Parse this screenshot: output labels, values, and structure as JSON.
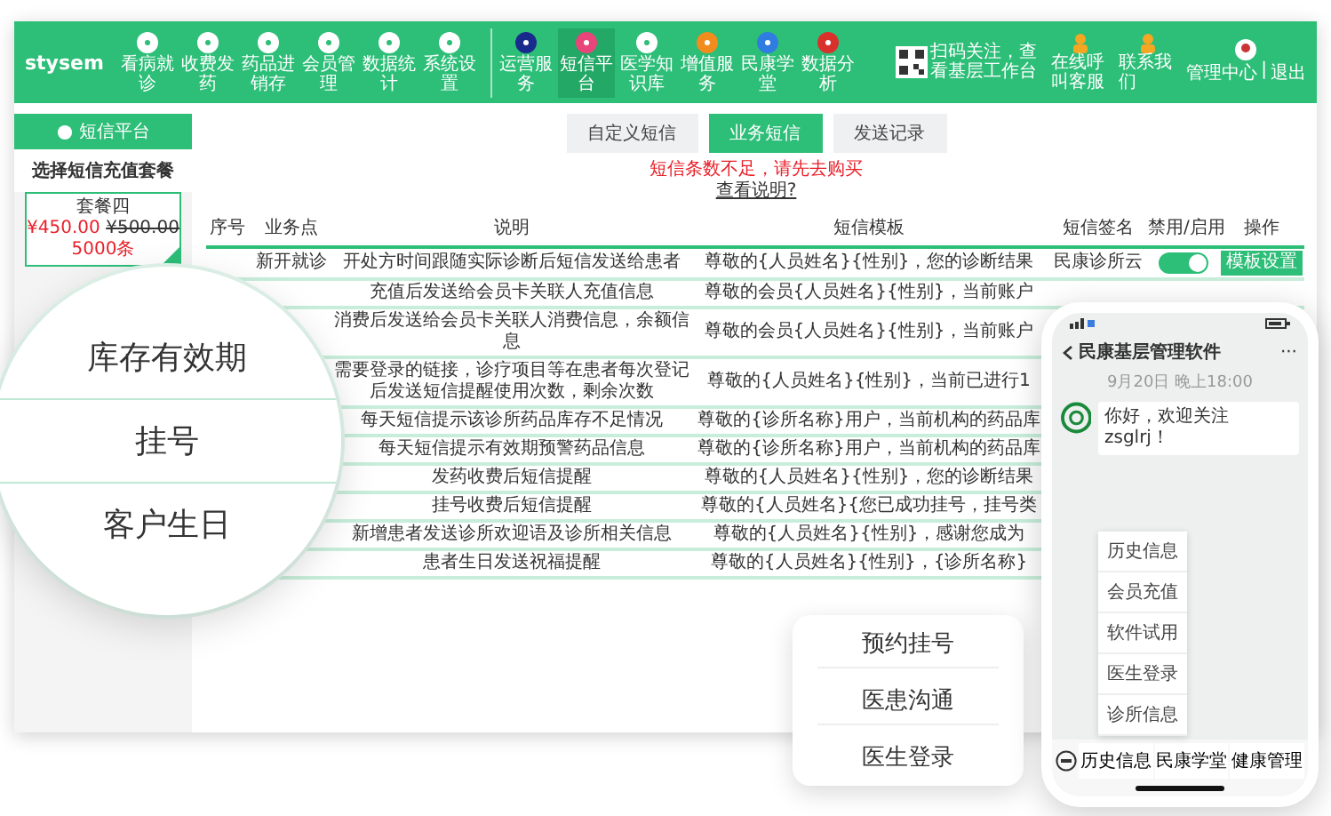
{
  "header": {
    "logo": "stysem",
    "nav_groups": [
      {
        "items": [
          {
            "label": "看病就诊",
            "selected": false,
            "color": "#ffffff"
          },
          {
            "label": "收费发药",
            "selected": false,
            "color": "#ffffff"
          },
          {
            "label": "药品进销存",
            "selected": false,
            "color": "#ffffff"
          },
          {
            "label": "会员管理",
            "selected": false,
            "color": "#ffffff"
          },
          {
            "label": "数据统计",
            "selected": false,
            "color": "#ffffff"
          },
          {
            "label": "系统设置",
            "selected": false,
            "color": "#ffffff"
          }
        ]
      },
      {
        "items": [
          {
            "label": "运营服务",
            "selected": false,
            "color": "#1a2a8c"
          },
          {
            "label": "短信平台",
            "selected": true,
            "color": "#e8457a"
          },
          {
            "label": "医学知识库",
            "selected": false,
            "color": "#ffffff"
          },
          {
            "label": "增值服务",
            "selected": false,
            "color": "#f28c1c"
          },
          {
            "label": "民康学堂",
            "selected": false,
            "color": "#2f7de1"
          },
          {
            "label": "数据分析",
            "selected": false,
            "color": "#d9302c"
          }
        ]
      }
    ],
    "qr_caption": "扫码关注，查看基层工作台",
    "links": [
      "在线呼叫客服",
      "联系我们"
    ],
    "user": {
      "label": "管理中心",
      "separator": "|",
      "logout": "退出"
    }
  },
  "sidebar": {
    "title": "短信平台",
    "heading": "选择短信充值套餐",
    "packages": [
      {
        "name": "套餐四",
        "price": "¥450.00",
        "original_price": "¥500.00",
        "quota": "5000条",
        "selected": true
      }
    ]
  },
  "tabs": [
    {
      "label": "自定义短信",
      "selected": false
    },
    {
      "label": "业务短信",
      "selected": true
    },
    {
      "label": "发送记录",
      "selected": false
    }
  ],
  "notice": {
    "warning": "短信条数不足，请先去购买",
    "link": "查看说明?"
  },
  "table": {
    "columns": [
      "序号",
      "业务点",
      "说明",
      "短信模板",
      "短信签名",
      "禁用/启用",
      "操作"
    ],
    "rows": [
      {
        "business": "新开就诊",
        "description": "开处方时间跟随实际诊断后短信发送给患者",
        "template": "尊敬的{人员姓名}{性别}，您的诊断结果",
        "signature": "民康诊所云",
        "enabled": true,
        "action": "模板设置"
      },
      {
        "description": "充值后发送给会员卡关联人充值信息",
        "template": "尊敬的会员{人员姓名}{性别}，当前账户"
      },
      {
        "description": "消费后发送给会员卡关联人消费信息，余额信息",
        "template": "尊敬的会员{人员姓名}{性别}，当前账户"
      },
      {
        "description": "需要登录的链接，诊疗项目等在患者每次登记后发送短信提醒使用次数，剩余次数",
        "template": "尊敬的{人员姓名}{性别}，当前已进行1"
      },
      {
        "description": "每天短信提示该诊所药品库存不足情况",
        "template": "尊敬的{诊所名称}用户，当前机构的药品库"
      },
      {
        "description": "每天短信提示有效期预警药品信息",
        "template": "尊敬的{诊所名称}用户，当前机构的药品库"
      },
      {
        "description": "发药收费后短信提醒",
        "template": "尊敬的{人员姓名}{性别}，您的诊断结果"
      },
      {
        "description": "挂号收费后短信提醒",
        "template": "尊敬的{人员姓名}{您已成功挂号，挂号类"
      },
      {
        "description": "新增患者发送诊所欢迎语及诊所相关信息",
        "template": "尊敬的{人员姓名}{性别}，感谢您成为"
      },
      {
        "description": "患者生日发送祝福提醒",
        "template": "尊敬的{人员姓名}{性别}，{诊所名称}"
      }
    ]
  },
  "magnifier": {
    "items": [
      "库存有效期",
      "挂号",
      "客户生日"
    ]
  },
  "phone": {
    "title": "民康基层管理软件",
    "more": "···",
    "timestamp": "9月20日 晚上18:00",
    "messages": [
      {
        "text": "你好，欢迎关注 zsglrj！"
      }
    ],
    "menu": [
      "历史信息",
      "会员充值",
      "软件试用",
      "医生登录",
      "诊所信息"
    ],
    "tabs": [
      "历史信息",
      "民康学堂",
      "健康管理"
    ]
  },
  "callout": {
    "items": [
      "预约挂号",
      "医患沟通",
      "医生登录"
    ]
  }
}
